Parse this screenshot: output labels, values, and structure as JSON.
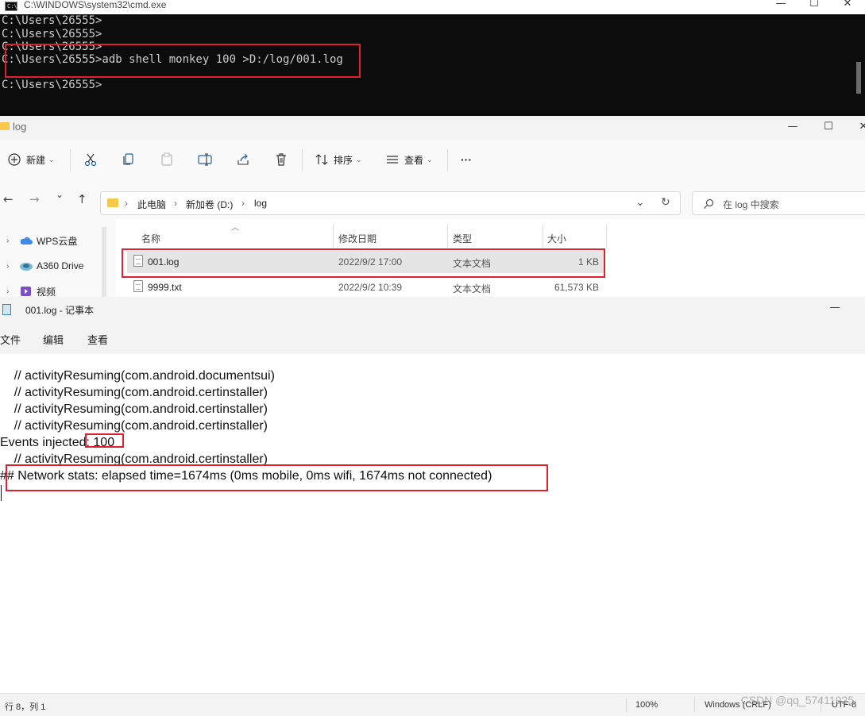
{
  "cmd": {
    "title": "C:\\WINDOWS\\system32\\cmd.exe",
    "icon_text": "C:\\",
    "controls": {
      "minimize": "—",
      "maximize": "☐",
      "close": "✕"
    },
    "lines": [
      "C:\\Users\\26555>",
      "C:\\Users\\26555>",
      "C:\\Users\\26555>",
      "C:\\Users\\26555>adb shell monkey 100 >D:/log/001.log",
      "",
      "C:\\Users\\26555>"
    ]
  },
  "explorer": {
    "title": "log",
    "controls": {
      "minimize": "—",
      "maximize": "☐",
      "close": "✕"
    },
    "toolbar": {
      "new_label": "新建",
      "sort_label": "排序",
      "view_label": "查看",
      "more_label": "···"
    },
    "nav": {
      "back": "←",
      "forward": "→",
      "recent": "⌄",
      "up": "↑"
    },
    "address": {
      "crumbs": [
        "此电脑",
        "新加卷 (D:)",
        "log"
      ],
      "sep": "›",
      "dropdown": "⌄",
      "refresh": "↻"
    },
    "search": {
      "placeholder": "在 log 中搜索"
    },
    "sidebar": {
      "items": [
        {
          "label": "WPS云盘"
        },
        {
          "label": "A360 Drive"
        },
        {
          "label": "视频"
        }
      ]
    },
    "columns": {
      "name": "名称",
      "date": "修改日期",
      "type": "类型",
      "size": "大小"
    },
    "files": [
      {
        "name": "001.log",
        "date": "2022/9/2 17:00",
        "type": "文本文档",
        "size": "1 KB",
        "selected": true
      },
      {
        "name": "9999.txt",
        "date": "2022/9/2 10:39",
        "type": "文本文档",
        "size": "61,573 KB",
        "selected": false
      }
    ]
  },
  "notepad": {
    "title": "001.log - 记事本",
    "controls": {
      "minimize": "—"
    },
    "menu": [
      "文件",
      "编辑",
      "查看"
    ],
    "lines": [
      "    // activityResuming(com.android.documentsui)",
      "    // activityResuming(com.android.certinstaller)",
      "    // activityResuming(com.android.certinstaller)",
      "    // activityResuming(com.android.certinstaller)",
      "Events injected: 100",
      "    // activityResuming(com.android.certinstaller)",
      "## Network stats: elapsed time=1674ms (0ms mobile, 0ms wifi, 1674ms not connected)"
    ],
    "status": {
      "position": "行 8，列 1",
      "zoom": "100%",
      "line_ending": "Windows (CRLF)",
      "encoding": "UTF-8"
    }
  },
  "watermark": "CSDN @qq_57411925",
  "colors": {
    "highlight_box": "#e02030",
    "cmd_bg": "#0c0c0c",
    "cmd_fg": "#cccccc",
    "selection": "#e5e5e5"
  }
}
